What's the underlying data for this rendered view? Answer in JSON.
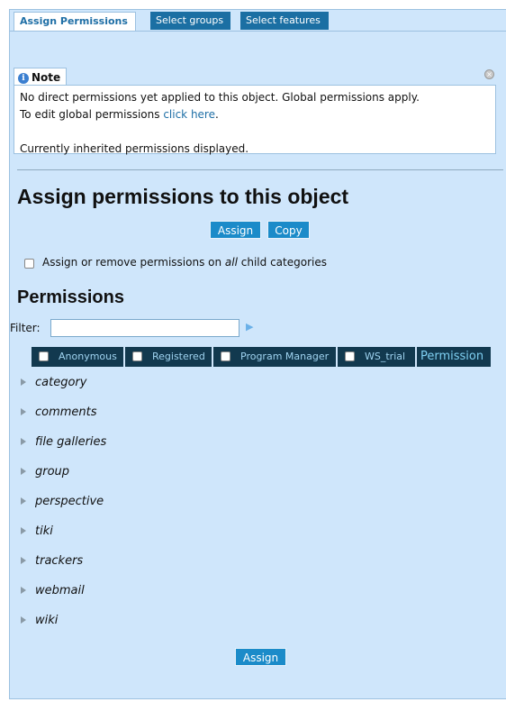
{
  "tabs": [
    {
      "label": "Assign Permissions",
      "active": true
    },
    {
      "label": "Select groups",
      "active": false
    },
    {
      "label": "Select features",
      "active": false
    }
  ],
  "note": {
    "title": "Note",
    "line1": "No direct permissions yet applied to this object. Global permissions apply.",
    "line2_prefix": "To edit global permissions ",
    "link_text": "click here",
    "line2_suffix": ".",
    "line3": "Currently inherited permissions displayed."
  },
  "assign_heading": "Assign permissions to this object",
  "buttons": {
    "assign": "Assign",
    "copy": "Copy",
    "assign_bottom": "Assign"
  },
  "child_categories": {
    "prefix": "Assign or remove permissions on ",
    "emphasis": "all",
    "suffix": " child categories",
    "checked": false
  },
  "permissions_heading": "Permissions",
  "filter": {
    "label": "Filter:",
    "value": "",
    "placeholder": ""
  },
  "columns": [
    {
      "label": "Anonymous",
      "checked": false
    },
    {
      "label": "Registered",
      "checked": false
    },
    {
      "label": "Program Manager",
      "checked": false
    },
    {
      "label": "WS_trial",
      "checked": false
    }
  ],
  "permission_column": "Permission",
  "tree_items": [
    "category",
    "comments",
    "file galleries",
    "group",
    "perspective",
    "tiki",
    "trackers",
    "webmail",
    "wiki"
  ],
  "colors": {
    "panel_bg": "#cfe6fb",
    "button_bg": "#1b8bc9",
    "header_bg": "#12394f",
    "link": "#1f6fa6"
  }
}
